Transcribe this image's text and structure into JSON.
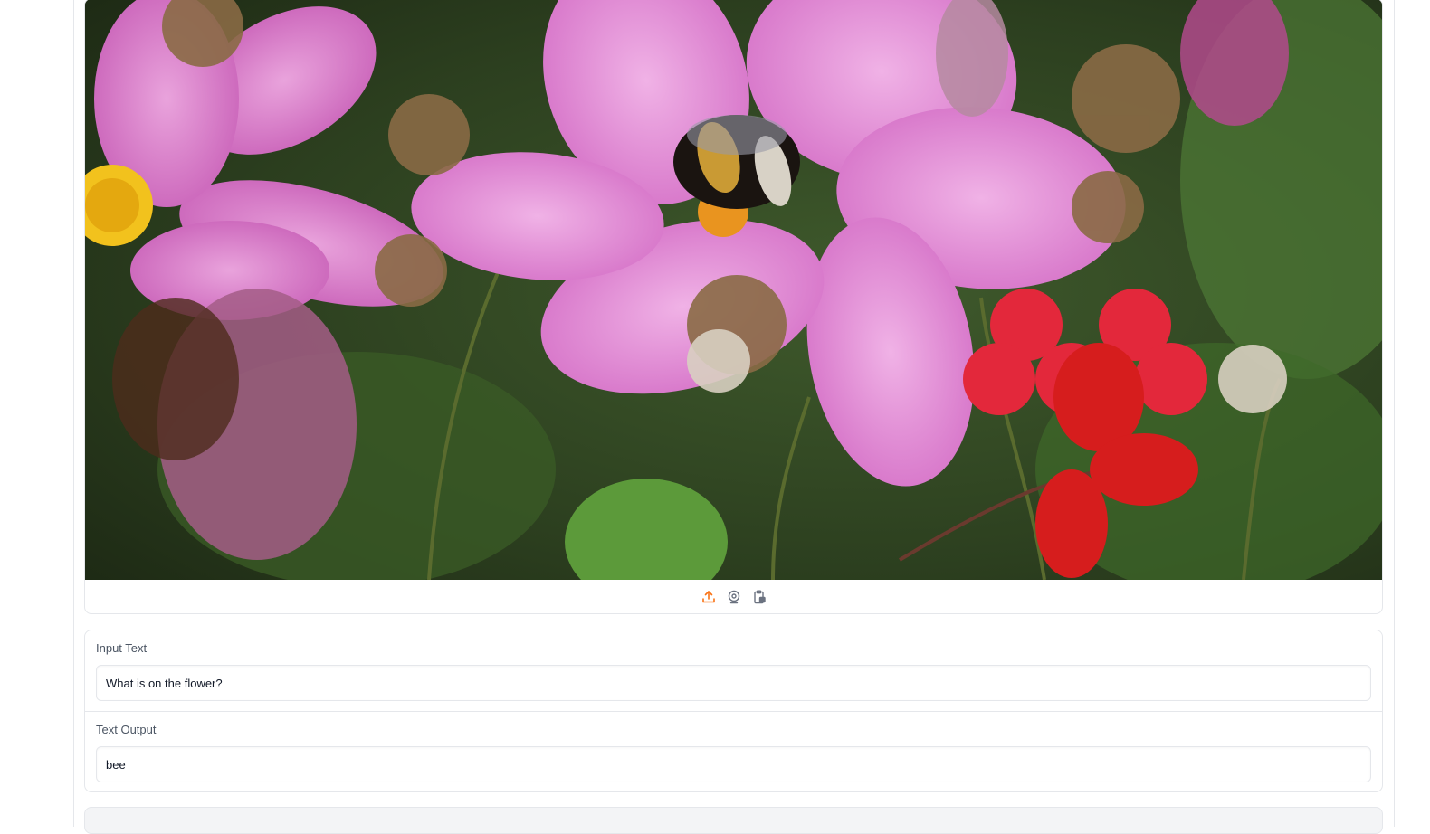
{
  "image_component": {
    "toolbar": [
      {
        "icon": "upload-icon",
        "color": "#f97316"
      },
      {
        "icon": "webcam-icon",
        "color": "#6b7280"
      },
      {
        "icon": "clipboard-paste-icon",
        "color": "#6b7280"
      }
    ]
  },
  "input_text": {
    "label": "Input Text",
    "value": "What is on the flower?"
  },
  "text_output": {
    "label": "Text Output",
    "value": "bee"
  },
  "colors": {
    "accent": "#f97316",
    "border": "#e5e7eb",
    "label": "#4b5563"
  }
}
